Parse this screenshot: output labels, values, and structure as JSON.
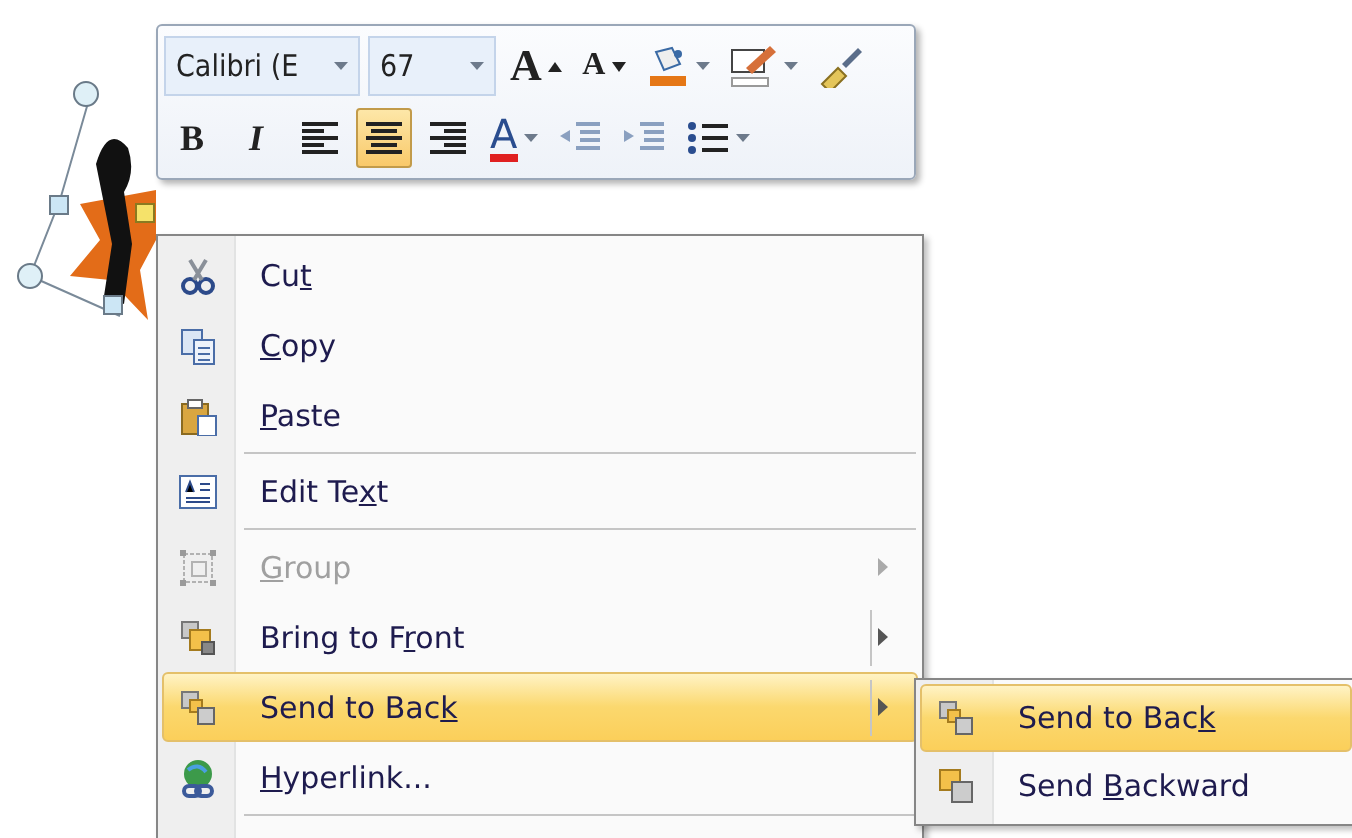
{
  "mini_toolbar": {
    "font": {
      "value": "Calibri (E"
    },
    "size": {
      "value": "67"
    },
    "row1": [
      {
        "kind": "grow",
        "label": "A"
      },
      {
        "kind": "shrink",
        "label": "A"
      },
      {
        "kind": "fill"
      },
      {
        "kind": "line"
      },
      {
        "kind": "painter"
      }
    ],
    "row2": [
      {
        "kind": "bold",
        "label": "B",
        "selected": false
      },
      {
        "kind": "italic",
        "label": "I",
        "selected": false
      },
      {
        "kind": "align-left",
        "selected": false
      },
      {
        "kind": "align-center",
        "selected": true
      },
      {
        "kind": "align-right",
        "selected": false
      },
      {
        "kind": "font-color",
        "label": "A",
        "selected": false
      },
      {
        "kind": "outdent",
        "selected": false
      },
      {
        "kind": "indent",
        "selected": false
      },
      {
        "kind": "bullets",
        "selected": false
      }
    ]
  },
  "context_menu": {
    "items": [
      {
        "kind": "cut",
        "before": "Cu",
        "key": "t",
        "disabled": false,
        "selected": false,
        "submenu": false,
        "split": false,
        "separator_after": false
      },
      {
        "kind": "copy",
        "key": "C",
        "after": "opy",
        "disabled": false,
        "selected": false,
        "submenu": false,
        "split": false,
        "separator_after": false
      },
      {
        "kind": "paste",
        "key": "P",
        "after": "aste",
        "disabled": false,
        "selected": false,
        "submenu": false,
        "split": false,
        "separator_after": true
      },
      {
        "kind": "edit-text",
        "before": "Edit Te",
        "key": "x",
        "after": "t",
        "disabled": false,
        "selected": false,
        "submenu": false,
        "split": false,
        "separator_after": true
      },
      {
        "kind": "group",
        "key": "G",
        "after": "roup",
        "disabled": true,
        "selected": false,
        "submenu": true,
        "split": false,
        "separator_after": false
      },
      {
        "kind": "bring-front",
        "before": "Bring to F",
        "key": "r",
        "after": "ont",
        "disabled": false,
        "selected": false,
        "submenu": true,
        "split": true,
        "separator_after": false
      },
      {
        "kind": "send-back",
        "before": "Send to Bac",
        "key": "k",
        "disabled": false,
        "selected": true,
        "submenu": true,
        "split": true,
        "separator_after": false
      },
      {
        "kind": "hyperlink",
        "key": "H",
        "after": "yperlink...",
        "disabled": false,
        "selected": false,
        "submenu": false,
        "split": false,
        "separator_after": true
      }
    ]
  },
  "submenu": {
    "items": [
      {
        "kind": "send-back",
        "before": "Send to Bac",
        "key": "k",
        "selected": true
      },
      {
        "kind": "send-backward",
        "before": "Send ",
        "key": "B",
        "after": "ackward",
        "selected": false
      }
    ]
  }
}
